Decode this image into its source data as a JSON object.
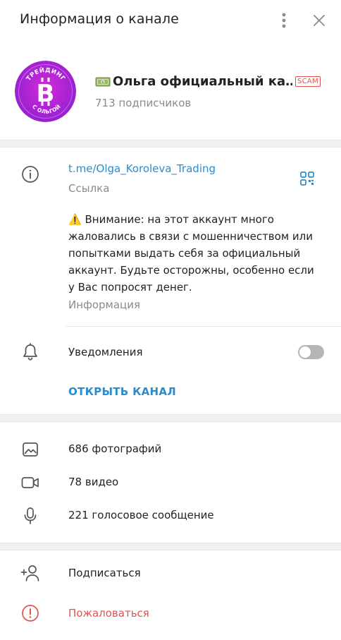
{
  "header": {
    "title": "Информация о канале",
    "more_icon": "more-vertical-icon",
    "close_icon": "close-icon"
  },
  "profile": {
    "avatar_top_text": "ТРЕЙДИНГ",
    "avatar_bottom_text": "С ОЛЬГОЙ",
    "avatar_symbol": "B",
    "name": "Ольга официальный ка…",
    "scam_badge": "SCAM",
    "subscribers": "713 подписчиков"
  },
  "info": {
    "link": "t.me/Olga_Koroleva_Trading",
    "link_caption": "Ссылка",
    "warning_icon": "⚠️",
    "warning_text": "Внимание: на этот аккаунт много жаловались в связи с мошенничеством или попытками выдать себя за официальный аккаунт. Будьте осторожны, особенно если у Вас попросят денег.",
    "info_caption": "Информация",
    "notifications_label": "Уведомления",
    "notifications_enabled": false,
    "open_channel_label": "ОТКРЫТЬ КАНАЛ"
  },
  "media": {
    "photos": "686 фотографий",
    "videos": "78 видео",
    "voice": "221 голосовое сообщение"
  },
  "actions": {
    "subscribe": "Подписаться",
    "report": "Пожаловаться"
  },
  "colors": {
    "accent": "#2b8ccd",
    "danger": "#e0534f",
    "avatar_purple": "#8f1fd0",
    "avatar_magenta": "#d42ad8"
  }
}
